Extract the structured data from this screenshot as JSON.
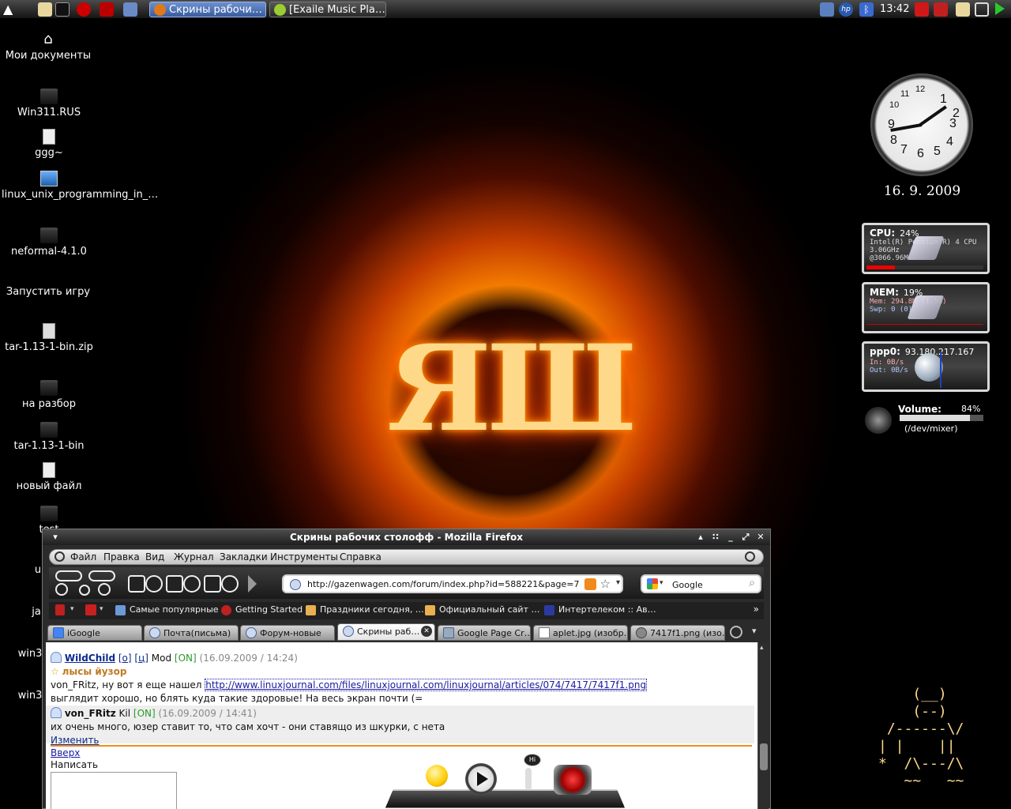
{
  "top_panel": {
    "tasks": [
      {
        "label": "Скрины рабочи…",
        "active": true
      },
      {
        "label": "[Exaile Music Pla…",
        "active": false
      }
    ],
    "clock": "13:42"
  },
  "desktop_icons": [
    {
      "label": "Мои документы",
      "icon": "home-icon"
    },
    {
      "label": "Win311.RUS",
      "icon": "folder-icon"
    },
    {
      "label": "ggg~",
      "icon": "text-file-icon"
    },
    {
      "label": "linux_unix_programming_in_…",
      "icon": "image-file-icon"
    },
    {
      "label": "neformal-4.1.0",
      "icon": "folder-icon"
    },
    {
      "label": "Запустить игру",
      "icon": ""
    },
    {
      "label": "tar-1.13-1-bin.zip",
      "icon": "archive-icon"
    },
    {
      "label": "на разбор",
      "icon": "folder-icon"
    },
    {
      "label": "tar-1.13-1-bin",
      "icon": "folder-icon"
    },
    {
      "label": "новый файл",
      "icon": "text-file-icon"
    },
    {
      "label": "test",
      "icon": "folder-icon"
    },
    {
      "label": "u",
      "icon": ""
    },
    {
      "label": "ja",
      "icon": ""
    },
    {
      "label": "win3",
      "icon": ""
    },
    {
      "label": "win3",
      "icon": ""
    }
  ],
  "clock_desklet": {
    "date": "16. 9. 2009",
    "numbers": [
      "12",
      "1",
      "2",
      "3",
      "4",
      "5",
      "6",
      "7",
      "8",
      "9",
      "10",
      "11"
    ]
  },
  "monitors": {
    "cpu": {
      "title": "CPU:",
      "value": "24%",
      "line1": "Intel(R) Pentium(R) 4 CPU",
      "line2": "3.06GHz",
      "line3": "@3066.96M",
      "usage": 0.24
    },
    "mem": {
      "title": "MEM:",
      "value": "19%",
      "mem_line": "Mem: 294.8M (1.5G)",
      "swap_line": "Swp: 0 (0)"
    },
    "net": {
      "title": "ppp0:",
      "value": "93.180.217.167",
      "in_line": "In:   0B/s",
      "out_line": "Out:  0B/s"
    }
  },
  "volume": {
    "label": "Volume:",
    "value": "84%",
    "level": 0.84,
    "device": "(/dev/mixer)"
  },
  "ascii_art": "    (__)\n    (--)\n /------\\/\n| |    ||\n*  /\\---/\\\n   ~~   ~~",
  "firefox": {
    "title": "Скрины рабочих столофф - Mozilla Firefox",
    "menu": [
      "Файл",
      "Правка",
      "Вид",
      "Журнал",
      "Закладки",
      "Инструменты",
      "Справка"
    ],
    "url": "http://gazenwagen.com/forum/index.php?id=588221&page=7",
    "search_engine": "Google",
    "bookmarks": [
      "Самые популярные",
      "Getting Started",
      "Праздники сегодня, …",
      "Официальный сайт …",
      "Интертелеком :: Ав…"
    ],
    "tabs": [
      "iGoogle",
      "Почта(письма)",
      "Форум-новые",
      "Скрины раб…",
      "Google Page Cr…",
      "aplet.jpg (изобр…",
      "7417f1.png (изо…"
    ],
    "active_tab": 3,
    "content": {
      "post1": {
        "author": "WildChild",
        "links": [
          "[о]",
          "[ц]"
        ],
        "role": "Mod",
        "status": "[ON]",
        "date": "(16.09.2009 / 14:24)",
        "subject": "лысы йузор",
        "text_before_link": "von_FRitz, ну вот я еще нашел",
        "link": "http://www.linuxjournal.com/files/linuxjournal.com/linuxjournal/articles/074/7417/7417f1.png",
        "text2": "выглядит хорошо, но блять куда такие здоровые! На весь экран почти (="
      },
      "post2": {
        "author": "von_FRitz",
        "role": "Kil",
        "status": "[ON]",
        "date": "(16.09.2009 / 14:41)",
        "text": "их очень много, юзер ставит то, что сам хочт - они ставящо из шкурки, с нета",
        "edit": "Изменить"
      },
      "up": "Вверх",
      "write": "Написать"
    }
  }
}
